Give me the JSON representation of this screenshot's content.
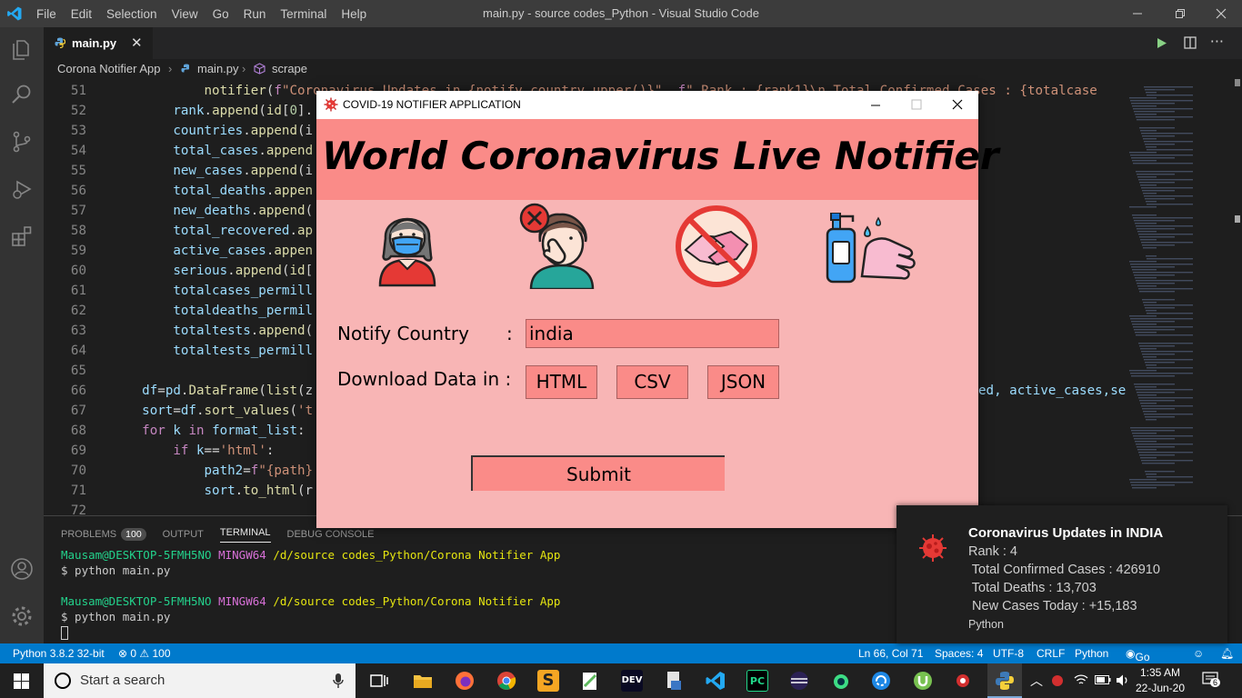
{
  "vscode": {
    "menu": [
      "File",
      "Edit",
      "Selection",
      "View",
      "Go",
      "Run",
      "Terminal",
      "Help"
    ],
    "window_title": "main.py - source codes_Python - Visual Studio Code",
    "tab_label": "main.py",
    "breadcrumb": [
      "Corona Notifier App",
      "main.py",
      "scrape"
    ],
    "code_lines": [
      {
        "n": "51",
        "indent": "            ",
        "segs": [
          [
            "fn",
            "notifier"
          ],
          [
            "",
            "("
          ],
          [
            "kw",
            "f"
          ],
          [
            "str",
            "\"Coronavirus Updates in {notify_country.upper()}\""
          ],
          [
            "",
            ", "
          ],
          [
            "kw",
            "f"
          ],
          [
            "str",
            "\" Rank : {rank1}\\n Total Confirmed Cases : {totalcase"
          ]
        ]
      },
      {
        "n": "52",
        "indent": "        ",
        "segs": [
          [
            "var",
            "rank"
          ],
          [
            "",
            "."
          ],
          [
            "fn",
            "append"
          ],
          [
            "",
            "("
          ],
          [
            "fn",
            "id"
          ],
          [
            "",
            "["
          ],
          [
            "num",
            "0"
          ],
          [
            "",
            "]."
          ]
        ]
      },
      {
        "n": "53",
        "indent": "        ",
        "segs": [
          [
            "var",
            "countries"
          ],
          [
            "",
            "."
          ],
          [
            "fn",
            "append"
          ],
          [
            "",
            "(i"
          ]
        ]
      },
      {
        "n": "54",
        "indent": "        ",
        "segs": [
          [
            "var",
            "total_cases"
          ],
          [
            "",
            "."
          ],
          [
            "fn",
            "append"
          ]
        ]
      },
      {
        "n": "55",
        "indent": "        ",
        "segs": [
          [
            "var",
            "new_cases"
          ],
          [
            "",
            "."
          ],
          [
            "fn",
            "append"
          ],
          [
            "",
            "(i"
          ]
        ]
      },
      {
        "n": "56",
        "indent": "        ",
        "segs": [
          [
            "var",
            "total_deaths"
          ],
          [
            "",
            "."
          ],
          [
            "fn",
            "appen"
          ]
        ]
      },
      {
        "n": "57",
        "indent": "        ",
        "segs": [
          [
            "var",
            "new_deaths"
          ],
          [
            "",
            "."
          ],
          [
            "fn",
            "append"
          ],
          [
            "",
            "("
          ]
        ]
      },
      {
        "n": "58",
        "indent": "        ",
        "segs": [
          [
            "var",
            "total_recovered"
          ],
          [
            "",
            "."
          ],
          [
            "fn",
            "ap"
          ]
        ]
      },
      {
        "n": "59",
        "indent": "        ",
        "segs": [
          [
            "var",
            "active_cases"
          ],
          [
            "",
            "."
          ],
          [
            "fn",
            "appen"
          ]
        ]
      },
      {
        "n": "60",
        "indent": "        ",
        "segs": [
          [
            "var",
            "serious"
          ],
          [
            "",
            "."
          ],
          [
            "fn",
            "append"
          ],
          [
            "",
            "("
          ],
          [
            "fn",
            "id"
          ],
          [
            "",
            "["
          ]
        ]
      },
      {
        "n": "61",
        "indent": "        ",
        "segs": [
          [
            "var",
            "totalcases_permill"
          ]
        ]
      },
      {
        "n": "62",
        "indent": "        ",
        "segs": [
          [
            "var",
            "totaldeaths_permil"
          ]
        ]
      },
      {
        "n": "63",
        "indent": "        ",
        "segs": [
          [
            "var",
            "totaltests"
          ],
          [
            "",
            "."
          ],
          [
            "fn",
            "append"
          ],
          [
            "",
            "("
          ]
        ]
      },
      {
        "n": "64",
        "indent": "        ",
        "segs": [
          [
            "var",
            "totaltests_permill"
          ]
        ]
      },
      {
        "n": "65",
        "indent": "",
        "segs": []
      },
      {
        "n": "66",
        "indent": "    ",
        "segs": [
          [
            "var",
            "df"
          ],
          [
            "",
            "="
          ],
          [
            "var",
            "pd"
          ],
          [
            "",
            "."
          ],
          [
            "fn",
            "DataFrame"
          ],
          [
            "",
            "("
          ],
          [
            "fn",
            "list"
          ],
          [
            "",
            "(z"
          ]
        ]
      },
      {
        "n": "67",
        "indent": "    ",
        "segs": [
          [
            "var",
            "sort"
          ],
          [
            "",
            "="
          ],
          [
            "var",
            "df"
          ],
          [
            "",
            "."
          ],
          [
            "fn",
            "sort_values"
          ],
          [
            "",
            "("
          ],
          [
            "str",
            "'t"
          ]
        ]
      },
      {
        "n": "68",
        "indent": "    ",
        "segs": [
          [
            "kw",
            "for"
          ],
          [
            "",
            " "
          ],
          [
            "var",
            "k"
          ],
          [
            "",
            " "
          ],
          [
            "kw",
            "in"
          ],
          [
            "",
            " "
          ],
          [
            "var",
            "format_list"
          ],
          [
            "",
            ":"
          ]
        ]
      },
      {
        "n": "69",
        "indent": "        ",
        "segs": [
          [
            "kw",
            "if"
          ],
          [
            "",
            " "
          ],
          [
            "var",
            "k"
          ],
          [
            "",
            "=="
          ],
          [
            "str",
            "'html'"
          ],
          [
            "",
            ":"
          ]
        ]
      },
      {
        "n": "70",
        "indent": "            ",
        "segs": [
          [
            "var",
            "path2"
          ],
          [
            "",
            "="
          ],
          [
            "kw",
            "f"
          ],
          [
            "str",
            "\"{path}"
          ]
        ]
      },
      {
        "n": "71",
        "indent": "            ",
        "segs": [
          [
            "var",
            "sort"
          ],
          [
            "",
            "."
          ],
          [
            "fn",
            "to_html"
          ],
          [
            "",
            "(r"
          ]
        ]
      },
      {
        "n": "72",
        "indent": "",
        "segs": []
      }
    ],
    "line66_tail": "ed, active_cases,se",
    "panel_tabs": [
      "PROBLEMS",
      "OUTPUT",
      "TERMINAL",
      "DEBUG CONSOLE"
    ],
    "problems_count": "100",
    "terminal": {
      "user": "Mausam@DESKTOP-5FMH5NO",
      "shell": "MINGW64",
      "path": "/d/source codes_Python/Corona Notifier App",
      "command": "$ python main.py"
    },
    "status": {
      "interpreter": "Python 3.8.2 32-bit",
      "problems": "⊗ 0 ⚠ 100",
      "position": "Ln 66, Col 71",
      "spaces": "Spaces: 4",
      "encoding": "UTF-8",
      "eol": "CRLF",
      "language": "Python",
      "live": "Go Live"
    }
  },
  "app": {
    "window_title": "COVID-19 NOTIFIER APPLICATION",
    "banner": "World Coronavirus Live Notifier",
    "country_label": "Notify Country",
    "colon": ":",
    "country_value": "india",
    "download_label": "Download Data in :",
    "formats": [
      "HTML",
      "CSV",
      "JSON"
    ],
    "submit": "Submit",
    "icons": [
      "mask-person-icon",
      "no-face-touch-icon",
      "no-handshake-icon",
      "hand-sanitizer-icon"
    ],
    "accent": "#fa8b88",
    "background": "#f8b5b5"
  },
  "toast": {
    "title": "Coronavirus Updates in INDIA",
    "rank": "Rank : 4",
    "total_cases": " Total Confirmed Cases : 426910",
    "total_deaths": " Total Deaths : 13,703",
    "new_cases": " New Cases Today : +15,183",
    "source": "Python"
  },
  "taskbar": {
    "search_placeholder": "Start a search",
    "time": "1:35 AM",
    "date": "22-Jun-20",
    "notifications": "6"
  }
}
